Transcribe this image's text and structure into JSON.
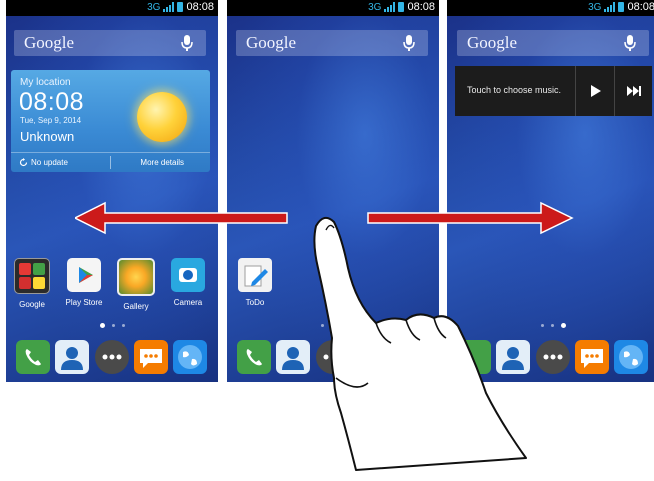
{
  "status": {
    "network": "3G",
    "time": "08:08"
  },
  "search": {
    "label": "Google"
  },
  "weather": {
    "location": "My location",
    "time": "08:08",
    "date": "Tue, Sep 9, 2014",
    "condition": "Unknown",
    "update_label": "No update",
    "more_label": "More details"
  },
  "screen1_apps": [
    {
      "label": "Google",
      "icon": "google-folder-icon"
    },
    {
      "label": "Play Store",
      "icon": "play-store-icon"
    },
    {
      "label": "Gallery",
      "icon": "gallery-icon"
    },
    {
      "label": "Camera",
      "icon": "camera-icon"
    }
  ],
  "screen2_apps": [
    {
      "label": "ToDo",
      "icon": "todo-icon"
    }
  ],
  "music": {
    "prompt": "Touch to choose music."
  },
  "dock": [
    {
      "icon": "phone-icon"
    },
    {
      "icon": "contacts-icon"
    },
    {
      "icon": "apps-drawer-icon"
    },
    {
      "icon": "messaging-icon"
    },
    {
      "icon": "browser-icon"
    }
  ],
  "pages": {
    "count": 3
  },
  "colors": {
    "status_accent": "#33b5e5",
    "swipe_arrow": "#cc1a1a"
  }
}
